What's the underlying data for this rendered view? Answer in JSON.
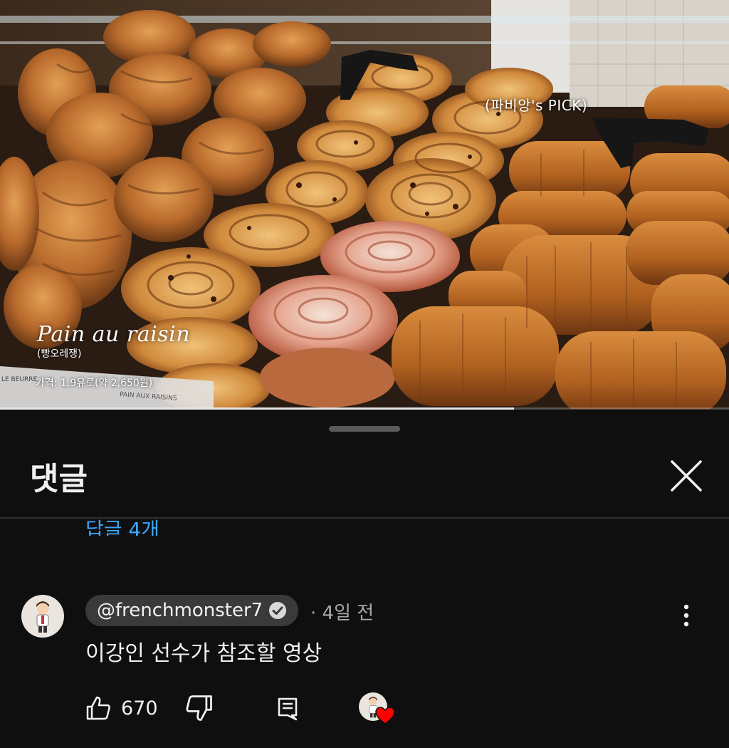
{
  "video": {
    "overlay_title": "Pain au raisin",
    "overlay_korean": "(빵오레쟁)",
    "overlay_price": "가격: 1.9유로(약 2,650원)",
    "overlay_pick": "(파비앙's PICK)",
    "sign_text": "PAIN AUX RAISINS",
    "sign_text_left": "LE BEURRE",
    "progress": 0.705
  },
  "comments_panel": {
    "title": "댓글",
    "close_icon": "close-icon",
    "replies_link": "답글 4개"
  },
  "comment": {
    "author_handle": "@frenchmonster7",
    "verified_icon": "verified-check-icon",
    "time": "· 4일 전",
    "text": "이강인 선수가 참조할 영상",
    "like_count": "670",
    "like_icon": "thumbs-up-icon",
    "dislike_icon": "thumbs-down-icon",
    "reply_icon": "reply-icon",
    "more_icon": "more-vertical-icon",
    "creator_heart_icon": "creator-heart-icon"
  },
  "colors": {
    "background": "#0f0f0f",
    "link_blue": "#3ea6ff",
    "chip_bg": "#3a3a3a",
    "muted_text": "#aaaaaa",
    "heart_red": "#ff0000"
  }
}
